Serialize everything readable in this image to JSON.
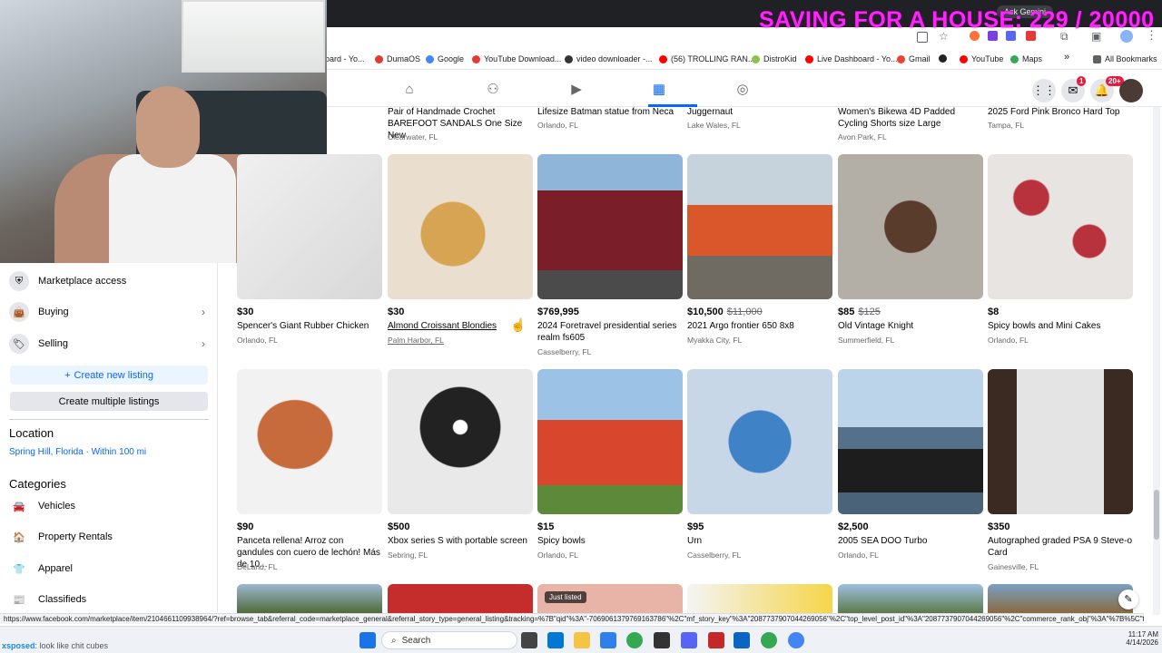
{
  "overlay": {
    "title": "SAVING FOR A HOUSE: 229 / 20000",
    "ask_gemini": "Ask Gemini"
  },
  "bookmarks": [
    {
      "label": "oard - Yo...",
      "color": "#1877f2"
    },
    {
      "label": "DumaOS",
      "color": "#e53935"
    },
    {
      "label": "Google",
      "color": "#4285f4"
    },
    {
      "label": "YouTube Download...",
      "color": "#e53935"
    },
    {
      "label": "video downloader -...",
      "color": "#333333"
    },
    {
      "label": "(56) TROLLING RAN...",
      "color": "#ff0000"
    },
    {
      "label": "DistroKid",
      "color": "#8bc34a"
    },
    {
      "label": "Live Dashboard - Yo...",
      "color": "#ff0000"
    },
    {
      "label": "Gmail",
      "color": "#ea4335"
    },
    {
      "label": "",
      "color": "#222222"
    },
    {
      "label": "YouTube",
      "color": "#ff0000"
    },
    {
      "label": "Maps",
      "color": "#34a853"
    },
    {
      "label": "All Bookmarks",
      "color": "#5f6368"
    }
  ],
  "fbnav": {
    "messenger_badge": "1",
    "notif_badge": "20+"
  },
  "sidebar": {
    "items": [
      {
        "label": "Marketplace access",
        "icon": "shield-icon"
      },
      {
        "label": "Buying",
        "icon": "bag-icon"
      },
      {
        "label": "Selling",
        "icon": "tag-icon"
      }
    ],
    "create_listing": "Create new listing",
    "create_multiple": "Create multiple listings",
    "location_heading": "Location",
    "location_value": "Spring Hill, Florida · Within 100 mi",
    "categories_heading": "Categories",
    "categories": [
      "Vehicles",
      "Property Rentals",
      "Apparel",
      "Classifieds"
    ]
  },
  "top_row": [
    {
      "title": "Pair of Handmade Crochet BAREFOOT SANDALS One Size New",
      "loc": "Clearwater, FL"
    },
    {
      "title": "Lifesize Batman statue from Neca",
      "loc": "Orlando, FL"
    },
    {
      "title": "Juggernaut",
      "loc": "Lake Wales, FL"
    },
    {
      "title": "Women's Bikewa 4D Padded Cycling Shorts size Large",
      "loc": "Avon Park, FL"
    },
    {
      "title": "2025 Ford Pink Bronco Hard Top",
      "loc": "Tampa, FL"
    }
  ],
  "row1": [
    {
      "price": "$30",
      "orig": "",
      "title": "Spencer's Giant Rubber Chicken",
      "loc": "Orlando, FL"
    },
    {
      "price": "$30",
      "orig": "",
      "title": "Almond Croissant Blondies",
      "loc": "Palm Harbor, FL"
    },
    {
      "price": "$769,995",
      "orig": "",
      "title": "2024 Foretravel presidential series realm fs605",
      "loc": "Casselberry, FL"
    },
    {
      "price": "$10,500",
      "orig": "$11,000",
      "title": "2021 Argo frontier 650 8x8",
      "loc": "Myakka City, FL"
    },
    {
      "price": "$85",
      "orig": "$125",
      "title": "Old Vintage Knight",
      "loc": "Summerfield, FL"
    },
    {
      "price": "$8",
      "orig": "",
      "title": "Spicy bowls and Mini Cakes",
      "loc": "Orlando, FL"
    }
  ],
  "row2": [
    {
      "price": "$90",
      "orig": "",
      "title": "Panceta rellena! Arroz con gandules con cuero de lechón! Más de 10...",
      "loc": "DeLand, FL"
    },
    {
      "price": "$500",
      "orig": "",
      "title": "Xbox series S with portable screen",
      "loc": "Sebring, FL"
    },
    {
      "price": "$15",
      "orig": "",
      "title": "Spicy bowls",
      "loc": "Orlando, FL"
    },
    {
      "price": "$95",
      "orig": "",
      "title": "Urn",
      "loc": "Casselberry, FL"
    },
    {
      "price": "$2,500",
      "orig": "",
      "title": "2005 SEA DOO Turbo",
      "loc": "Orlando, FL"
    },
    {
      "price": "$350",
      "orig": "",
      "title": "Autographed graded PSA 9 Steve-o Card",
      "loc": "Gainesville, FL"
    }
  ],
  "row3_badge": "Just listed",
  "status_url": "https://www.facebook.com/marketplace/item/2104661109938964/?ref=browse_tab&referral_code=marketplace_general&referral_story_type=general_listing&tracking=%7B\"qid\"%3A\"-7069061379769163786\"%2C\"mf_story_key\"%3A\"2087737907044269056\"%2C\"top_level_post_id\"%3A\"2087737907044269056\"%2C\"commerce_rank_obj\"%3A\"%7B%5C\"ta...",
  "chat": {
    "user": "xsposed",
    "message": ": look like chit cubes"
  },
  "taskbar": {
    "search": "Search",
    "time": "11:17 AM",
    "date": "4/14/2026"
  }
}
